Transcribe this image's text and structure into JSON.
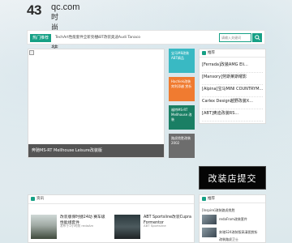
{
  "site": {
    "logo_number": "43",
    "logo_domain": "qc.com",
    "logo_chinese": "时尚改装"
  },
  "topbar": {
    "hot_label": "热门推荐",
    "news": [
      "TechArt性能套件全新亮相",
      "ABT改装奥迪Audi Tanaco"
    ],
    "search_placeholder": "请输入关键词"
  },
  "slider": {
    "caption": "奔驰MS-RT Mellhouse Leisure改装版"
  },
  "tiles": [
    {
      "text": "宝马M8改装ABT精品"
    },
    {
      "text": "Hachiek改装宾利添越 赏析"
    },
    {
      "text": "福特MS-RT Mellhouse 改装"
    },
    {
      "text": "路虎揽胜改装2002"
    }
  ],
  "side_box": {
    "title": "推荐",
    "items": [
      "[Ferrada]改装AMG Eli...",
      "[Mansory]劳斯莱斯曜影",
      "[Alpina]宝马MINI COUNTRYM...",
      "Carlex Design越野改装X...",
      "[ABT]奥迪改装RS..."
    ]
  },
  "promo": {
    "text": "改装店提交"
  },
  "news_box": {
    "title": "资讯",
    "items": [
      {
        "title": "改装版保时捷24动 赛车级性能组套件",
        "sub": "发布于2小时前 redaAm"
      },
      {
        "title": "ABT Sportsline改装Cupra Formentor",
        "sub": "ABT Sportsline"
      }
    ]
  },
  "side_box2": {
    "title": "推荐",
    "lines": [
      "[Inspire]改装路虎揽胜",
      "redaFrom改装套件",
      "奔驰S24改装版高清图赏析",
      "改装路虎卫士"
    ]
  }
}
